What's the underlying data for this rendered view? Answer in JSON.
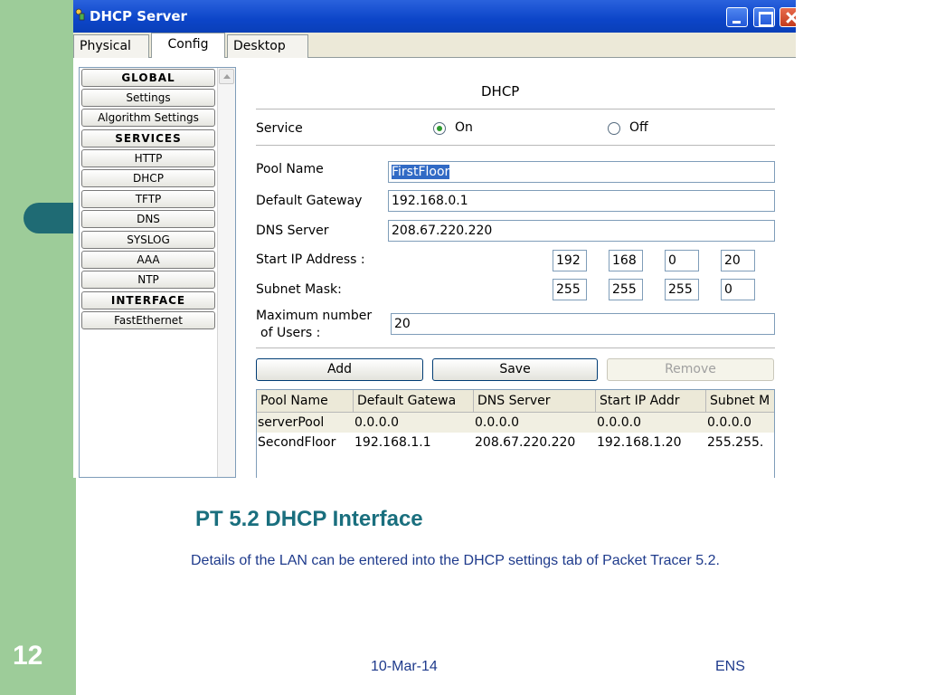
{
  "window": {
    "title": "DHCP Server",
    "tabs": [
      "Physical",
      "Config",
      "Desktop"
    ]
  },
  "nav": {
    "items": [
      {
        "label": "GLOBAL",
        "header": true
      },
      {
        "label": "Settings",
        "header": false
      },
      {
        "label": "Algorithm Settings",
        "header": false
      },
      {
        "label": "SERVICES",
        "header": true
      },
      {
        "label": "HTTP",
        "header": false
      },
      {
        "label": "DHCP",
        "header": false
      },
      {
        "label": "TFTP",
        "header": false
      },
      {
        "label": "DNS",
        "header": false
      },
      {
        "label": "SYSLOG",
        "header": false
      },
      {
        "label": "AAA",
        "header": false
      },
      {
        "label": "NTP",
        "header": false
      },
      {
        "label": "INTERFACE",
        "header": true
      },
      {
        "label": "FastEthernet",
        "header": false
      }
    ]
  },
  "form": {
    "title": "DHCP",
    "service_label": "Service",
    "on_label": "On",
    "off_label": "Off",
    "service_state": "On",
    "pool_name_label": "Pool Name",
    "pool_name_value": "FirstFloor",
    "gateway_label": "Default Gateway",
    "gateway_value": "192.168.0.1",
    "dns_label": "DNS Server",
    "dns_value": "208.67.220.220",
    "start_ip_label": "Start IP Address :",
    "start_ip": [
      "192",
      "168",
      "0",
      "20"
    ],
    "subnet_label": "Subnet Mask:",
    "subnet": [
      "255",
      "255",
      "255",
      "0"
    ],
    "max_users_label_line1": "Maximum number",
    "max_users_label_line2": "of Users :",
    "max_users_value": "20",
    "add_label": "Add",
    "save_label": "Save",
    "remove_label": "Remove"
  },
  "table": {
    "headers": [
      "Pool Name",
      "Default Gatewa",
      "DNS Server",
      "Start IP Addr",
      "Subnet M"
    ],
    "rows": [
      [
        "serverPool",
        "0.0.0.0",
        "0.0.0.0",
        "0.0.0.0",
        "0.0.0.0"
      ],
      [
        "SecondFloor",
        "192.168.1.1",
        "208.67.220.220",
        "192.168.1.20",
        "255.255."
      ]
    ]
  },
  "slide": {
    "title": "PT 5.2 DHCP Interface",
    "body": "Details of the LAN can be entered into the DHCP settings tab of Packet Tracer 5.2.",
    "number": "12",
    "date": "10-Mar-14",
    "org": "ENS"
  },
  "colors": {
    "sidebar_green": "#9dcc99",
    "accent_teal": "#1a6f7e",
    "text_blue": "#1f3b8c",
    "titlebar_blue": "#0c45c8"
  }
}
